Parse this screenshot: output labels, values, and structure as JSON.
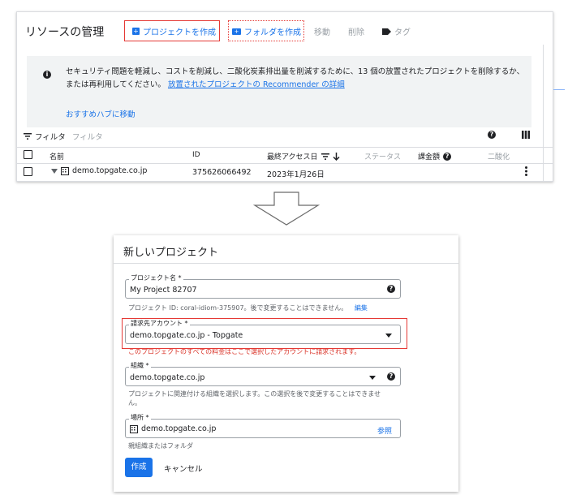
{
  "top_panel": {
    "title": "リソースの管理",
    "toolbar": {
      "create_project": "プロジェクトを作成",
      "create_folder": "フォルダを作成",
      "move": "移動",
      "delete": "削除",
      "tag": "タグ"
    },
    "banner": {
      "line1": "セキュリティ問題を軽減し、コストを削減し、二酸化炭素排出量を削減するために、13 個の放置されたプロジェクトを削除するか、",
      "line2_prefix": "または再利用してください。",
      "line2_link": "放置されたプロジェクトの Recommender の詳細",
      "hub_link": "おすすめハブに移動"
    },
    "filter": {
      "label": "フィルタ",
      "placeholder": "フィルタ"
    },
    "table": {
      "headers": {
        "name": "名前",
        "id": "ID",
        "last_access": "最終アクセス日",
        "status": "ステータス",
        "billing": "課金額",
        "co2": "二酸化"
      },
      "rows": [
        {
          "name": "demo.topgate.co.jp",
          "id": "375626066492",
          "last_access": "2023年1月26日"
        }
      ]
    }
  },
  "dialog": {
    "title": "新しいプロジェクト",
    "project_name": {
      "label": "プロジェクト名 *",
      "value": "My Project 82707",
      "hint_prefix": "プロジェクト ID: coral-idiom-375907。後で変更することはできません。",
      "hint_link": "編集"
    },
    "billing_account": {
      "label": "請求先アカウント *",
      "value": "demo.topgate.co.jp - Topgate",
      "hint": "このプロジェクトのすべての料金はここで選択したアカウントに請求されます。"
    },
    "organization": {
      "label": "組織 *",
      "value": "demo.topgate.co.jp",
      "hint_line1": "プロジェクトに関連付ける組織を選択します。この選択を後で変更することはできませ",
      "hint_line2": "ん。"
    },
    "location": {
      "label": "場所 *",
      "value": "demo.topgate.co.jp",
      "browse": "参照",
      "hint": "親組織またはフォルダ"
    },
    "create_button": "作成",
    "cancel_button": "キャンセル"
  }
}
